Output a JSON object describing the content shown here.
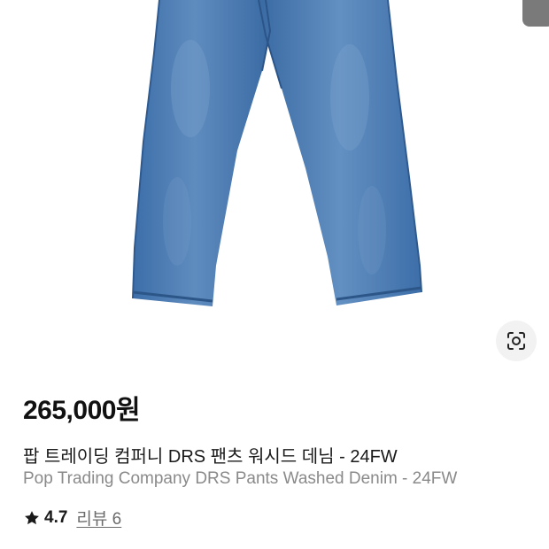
{
  "product": {
    "image_alt": "Blue washed denim pants",
    "price": "265,000원",
    "title_ko": "팝 트레이딩 컴퍼니 DRS 팬츠 워시드 데님 - 24FW",
    "title_en": "Pop Trading Company DRS Pants Washed Denim - 24FW",
    "rating": "4.7",
    "review_link": "리뷰 6"
  },
  "icons": {
    "lens": "visual-search-icon",
    "star": "star-icon"
  },
  "colors": {
    "denim": "#4a78ad",
    "denim_dark": "#2f5f96",
    "price_text": "#111111",
    "subtitle_text": "#8a8a8a",
    "review_link": "#6b6b6b"
  }
}
